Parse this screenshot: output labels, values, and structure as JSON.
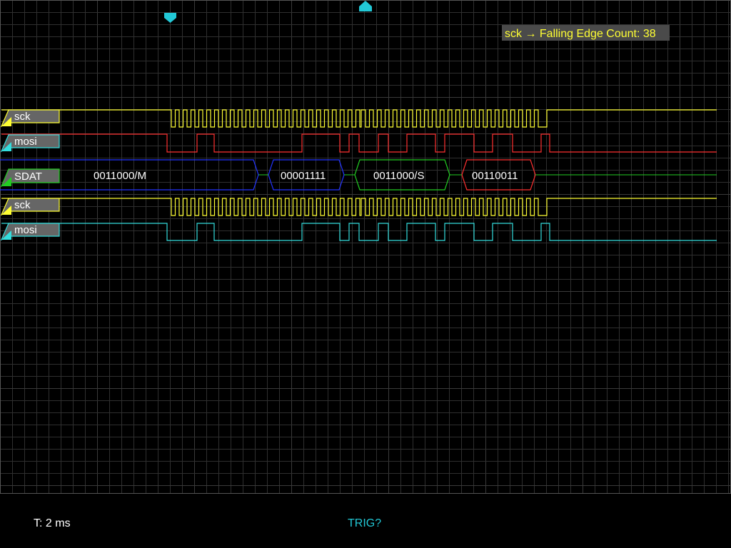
{
  "measurement": {
    "text": "sck → Falling Edge Count: 38"
  },
  "channels": [
    {
      "name": "sck",
      "color": "#ffff33"
    },
    {
      "name": "mosi",
      "color": "#ff3030"
    },
    {
      "name": "SDAT",
      "color": "#22cc22"
    },
    {
      "name": "sck",
      "color": "#ffff33"
    },
    {
      "name": "mosi",
      "color": "#33dddd"
    }
  ],
  "decode_packets": [
    {
      "text": "0011000/M",
      "color": "#2233ff"
    },
    {
      "text": "00001111",
      "color": "#2233ff"
    },
    {
      "text": "0011000/S",
      "color": "#22cc22"
    },
    {
      "text": "00110011",
      "color": "#ff3030"
    }
  ],
  "status": {
    "timebase": "T: 2 ms",
    "trigger": "TRIG?"
  },
  "colors": {
    "grid": "#2f2f2f",
    "grid_major": "#3a3a3a",
    "marker": "#22c8d6",
    "trigger_text": "#22c8d6",
    "measure_bg": "#4a4a4a"
  },
  "icons": {
    "cursor_marker_a": "marker-down-icon",
    "trigger_marker": "trigger-position-icon"
  }
}
